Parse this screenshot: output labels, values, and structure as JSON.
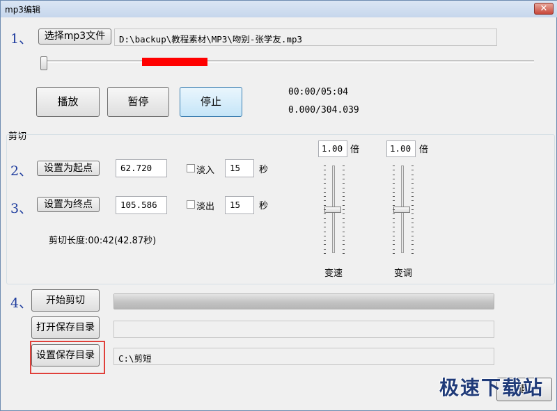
{
  "window": {
    "title": "mp3编辑",
    "close_label": "✕"
  },
  "step_numbers": [
    "1、",
    "2、",
    "3、",
    "4、"
  ],
  "file": {
    "select_button": "选择mp3文件",
    "path": "D:\\backup\\教程素材\\MP3\\吻别-张学友.mp3"
  },
  "seek": {
    "position_fraction": 0.0,
    "selection_start_fraction": 0.206,
    "selection_end_fraction": 0.339,
    "selection_color": "#ff0000"
  },
  "playback": {
    "play_label": "播放",
    "pause_label": "暂停",
    "stop_label": "停止",
    "time_display": "00:00/05:04",
    "seconds_display": "0.000/304.039"
  },
  "cut": {
    "group_label": "剪切",
    "set_start_label": "设置为起点",
    "start_value": "62.720",
    "fade_in_label": "淡入",
    "fade_in_value": "15",
    "fade_in_checked": false,
    "set_end_label": "设置为终点",
    "end_value": "105.586",
    "fade_out_label": "淡出",
    "fade_out_value": "15",
    "fade_out_checked": false,
    "seconds_unit": "秒",
    "length_text": "剪切长度:00:42(42.87秒)"
  },
  "speed": {
    "value": "1.00",
    "unit": "倍",
    "label": "变速",
    "level_fraction": 0.5
  },
  "pitch": {
    "value": "1.00",
    "unit": "倍",
    "label": "变调",
    "level_fraction": 0.5
  },
  "actions": {
    "start_cut_label": "开始剪切",
    "progress_fraction": 1.0,
    "open_dir_label": "打开保存目录",
    "open_dir_value": "",
    "set_dir_label": "设置保存目录",
    "save_dir": "C:\\剪短",
    "highlight_color": "#e0403a"
  },
  "bottom": {
    "partial_button_label": "退"
  },
  "watermark": "极速下载站"
}
